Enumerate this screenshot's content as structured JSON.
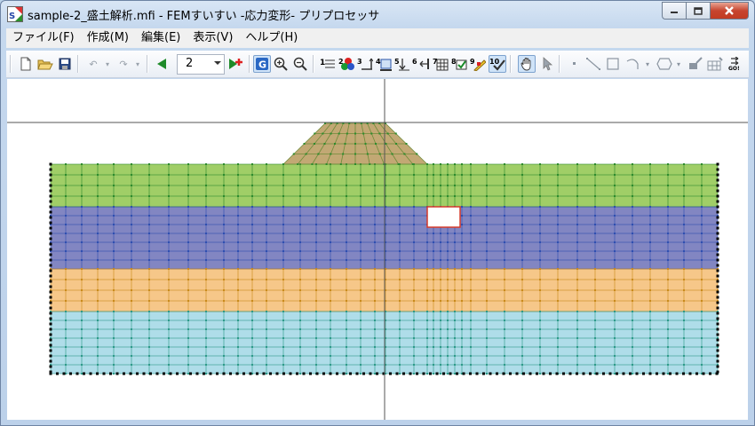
{
  "window": {
    "title": "sample-2_盛土解析.mfi - FEMすいすい -応力変形- プリプロセッサ"
  },
  "menu": [
    "ファイル(F)",
    "作成(M)",
    "編集(E)",
    "表示(V)",
    "ヘルプ(H)"
  ],
  "toolbar": {
    "page_select_value": "2",
    "icons": [
      "new-icon",
      "open-icon",
      "save-icon",
      "undo-icon",
      "redo-icon",
      "prev-page-icon",
      "add-page-icon",
      "grid-icon",
      "zoom-in-icon",
      "zoom-out-icon",
      "node-number-icon",
      "material-color-icon",
      "dimension-icon",
      "boundary-icon",
      "element-number-icon",
      "load-icon",
      "table-icon",
      "check-icon",
      "edit-material-icon",
      "property-icon",
      "hand-pan-icon",
      "pointer-icon",
      "point-icon",
      "line-icon",
      "rect-icon",
      "arc-icon",
      "polygon-icon",
      "erase-icon",
      "mesh-icon",
      "go-icon"
    ]
  },
  "canvas": {
    "colors": {
      "embankment": "#c2a874",
      "layer1": "#9bcb5f",
      "layer2": "#7b7fbf",
      "layer3": "#f6c483",
      "layer4": "#abdbe8",
      "mesh_green": "#2e8b2e",
      "mesh_blue": "#2f4fb0",
      "opening_border": "#d63a2a"
    }
  }
}
